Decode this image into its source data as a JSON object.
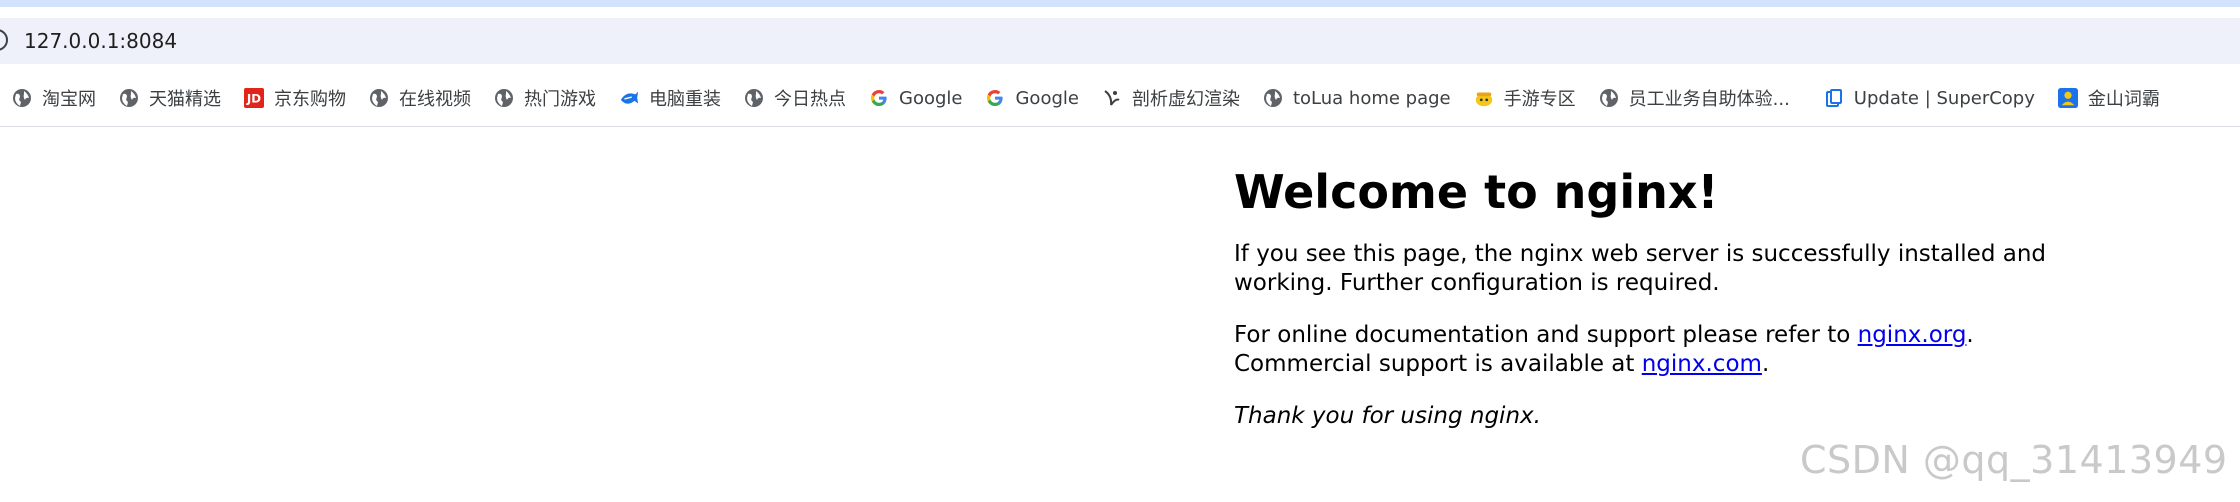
{
  "browser": {
    "url": "127.0.0.1:8084"
  },
  "bookmarks": [
    {
      "label": "淘宝网",
      "icon": "globe-icon"
    },
    {
      "label": "天猫精选",
      "icon": "globe-icon"
    },
    {
      "label": "京东购物",
      "icon": "jd-logo-icon"
    },
    {
      "label": "在线视频",
      "icon": "globe-icon"
    },
    {
      "label": "热门游戏",
      "icon": "globe-icon"
    },
    {
      "label": "电脑重装",
      "icon": "fish-icon"
    },
    {
      "label": "今日热点",
      "icon": "globe-icon"
    },
    {
      "label": "Google",
      "icon": "google-g-icon"
    },
    {
      "label": "Google",
      "icon": "google-g-icon"
    },
    {
      "label": "剖析虚幻渲染",
      "icon": "rocket-icon"
    },
    {
      "label": "toLua home page",
      "icon": "globe-icon"
    },
    {
      "label": "手游专区",
      "icon": "mascot-icon"
    },
    {
      "label": "员工业务自助体验...",
      "icon": "globe-icon"
    },
    {
      "label": "Update | SuperCopy",
      "icon": "document-icon"
    },
    {
      "label": "金山词霸",
      "icon": "user-card-icon"
    }
  ],
  "page": {
    "title": "Welcome to nginx!",
    "p1": "If you see this page, the nginx web server is successfully installed and working. Further configuration is required.",
    "p2_a": "For online documentation and support please refer to ",
    "p2_link1": "nginx.org",
    "p2_b": ".",
    "p2_c": "Commercial support is available at ",
    "p2_link2": "nginx.com",
    "p2_d": ".",
    "p3": "Thank you for using nginx."
  },
  "watermark": "CSDN @qq_31413949",
  "colors": {
    "link": "#0000ee",
    "top_strip": "#d3e3fd",
    "address_bar": "#eef1f9",
    "jd_red": "#e1251b"
  }
}
